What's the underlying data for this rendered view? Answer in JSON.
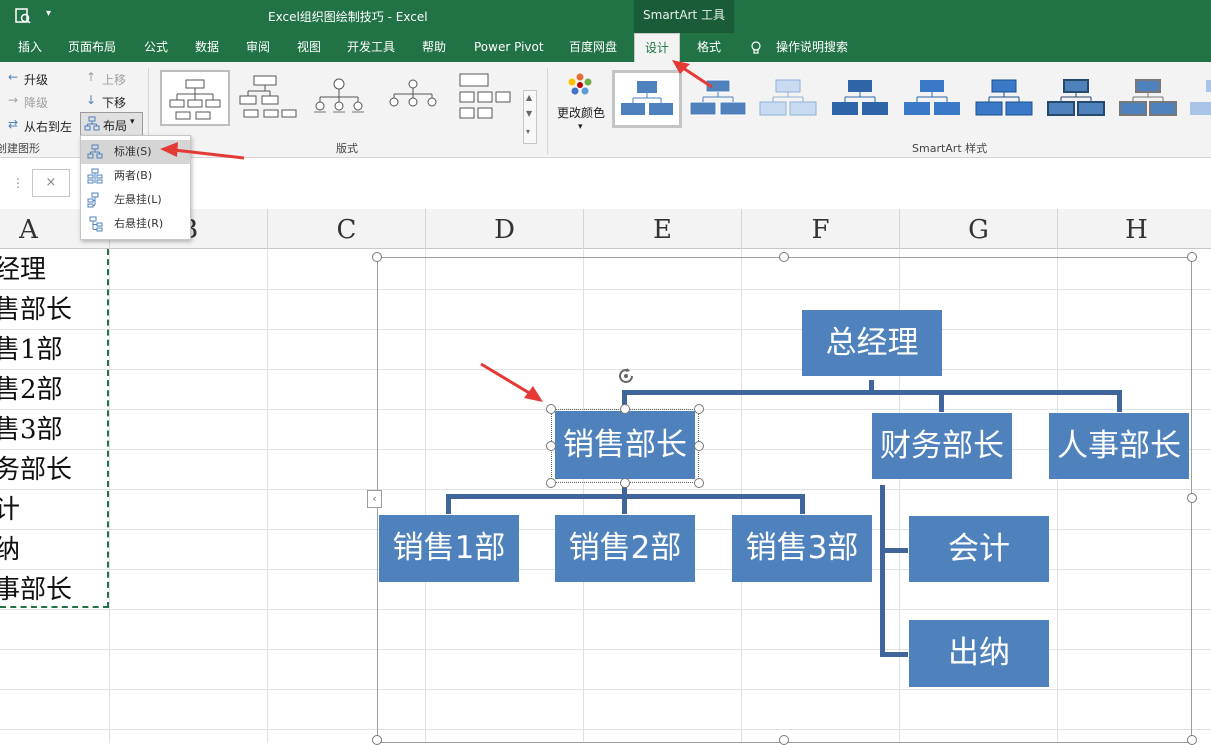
{
  "window": {
    "title": "Excel组织图绘制技巧  -  Excel",
    "context_tab_group": "SmartArt 工具",
    "accent": "#217346"
  },
  "tabs": [
    {
      "label": "插入"
    },
    {
      "label": "页面布局"
    },
    {
      "label": "公式"
    },
    {
      "label": "数据"
    },
    {
      "label": "审阅"
    },
    {
      "label": "视图"
    },
    {
      "label": "开发工具"
    },
    {
      "label": "帮助"
    },
    {
      "label": "Power Pivot"
    },
    {
      "label": "百度网盘"
    },
    {
      "label": "设计",
      "active": true
    },
    {
      "label": "格式"
    },
    {
      "label": "操作说明搜索"
    }
  ],
  "ribbon": {
    "create_graphic": {
      "promote": "升级",
      "demote": "降级",
      "right_to_left": "从右到左",
      "move_up": "上移",
      "move_down": "下移",
      "layout": "布局",
      "group_label": "创建图形"
    },
    "layouts_group_label": "版式",
    "change_colors": "更改颜色",
    "styles_group_label": "SmartArt 样式"
  },
  "layout_menu": {
    "items": [
      {
        "label": "标准(S)",
        "hotkey": "S",
        "highlighted": true
      },
      {
        "label": "两者(B)",
        "hotkey": "B"
      },
      {
        "label": "左悬挂(L)",
        "hotkey": "L"
      },
      {
        "label": "右悬挂(R)",
        "hotkey": "R"
      }
    ]
  },
  "formula_bar": {
    "cancel_symbol": "×"
  },
  "columns": [
    "A",
    "B",
    "C",
    "D",
    "E",
    "F",
    "G",
    "H"
  ],
  "column_a_cells": [
    "经理",
    "售部长",
    "售1部",
    "售2部",
    "售3部",
    "务部长",
    "计",
    "纳",
    "事部长"
  ],
  "org_chart": {
    "node_color": "#4f81bd",
    "connector_color": "#3f659c",
    "root": "总经理",
    "level2": [
      "销售部长",
      "财务部长",
      "人事部长"
    ],
    "sales_children": [
      "销售1部",
      "销售2部",
      "销售3部"
    ],
    "finance_children": [
      "会计",
      "出纳"
    ],
    "selected_node": "销售部长"
  },
  "annotations": {
    "arrow_color": "#e53935"
  }
}
